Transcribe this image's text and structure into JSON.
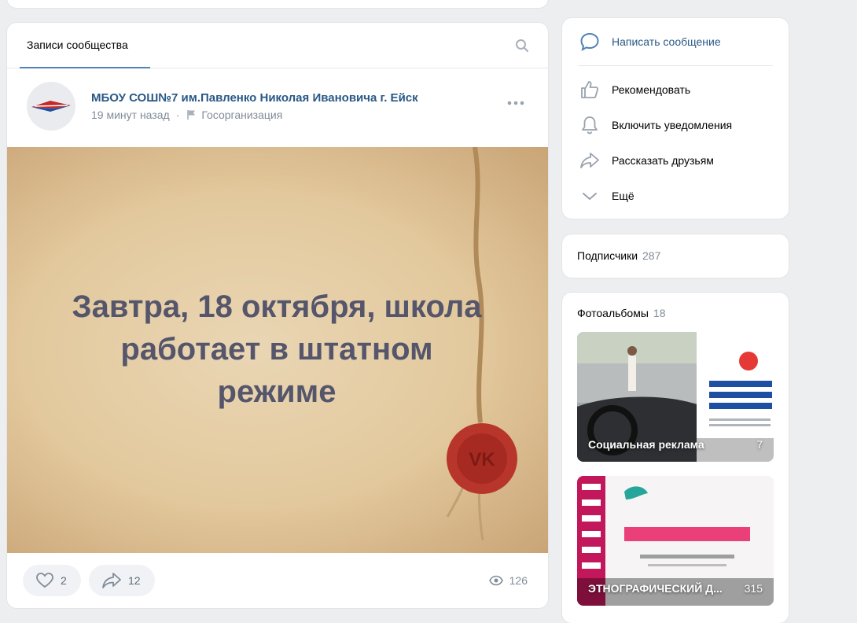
{
  "wall": {
    "tab_label": "Записи сообщества",
    "post": {
      "author": "МБОУ СОШ№7 им.Павленко Николая Ивановича г. Ейск",
      "time": "19 минут назад",
      "separator": "·",
      "type": "Госорганизация",
      "image_text_lines": [
        "Завтра, 18 октября, школа",
        "работает в штатном",
        "режиме"
      ],
      "likes": "2",
      "shares": "12",
      "views": "126"
    }
  },
  "actions": {
    "items": [
      {
        "label": "Написать сообщение",
        "icon": "message-icon"
      },
      {
        "label": "Рекомендовать",
        "icon": "thumbs-up-icon"
      },
      {
        "label": "Включить уведомления",
        "icon": "bell-icon"
      },
      {
        "label": "Рассказать друзьям",
        "icon": "share-icon"
      },
      {
        "label": "Ещё",
        "icon": "chevron-down-icon"
      }
    ]
  },
  "subscribers": {
    "label": "Подписчики",
    "count": "287"
  },
  "albums": {
    "label": "Фотоальбомы",
    "count": "18",
    "items": [
      {
        "title": "Социальная реклама",
        "count": "7"
      },
      {
        "title": "ЭТНОГРАФИЧЕСКИЙ Д...",
        "count": "315"
      }
    ]
  },
  "colors": {
    "accent": "#2a5885",
    "link": "#5181b8",
    "muted": "#818c99",
    "background": "#edeef0"
  }
}
